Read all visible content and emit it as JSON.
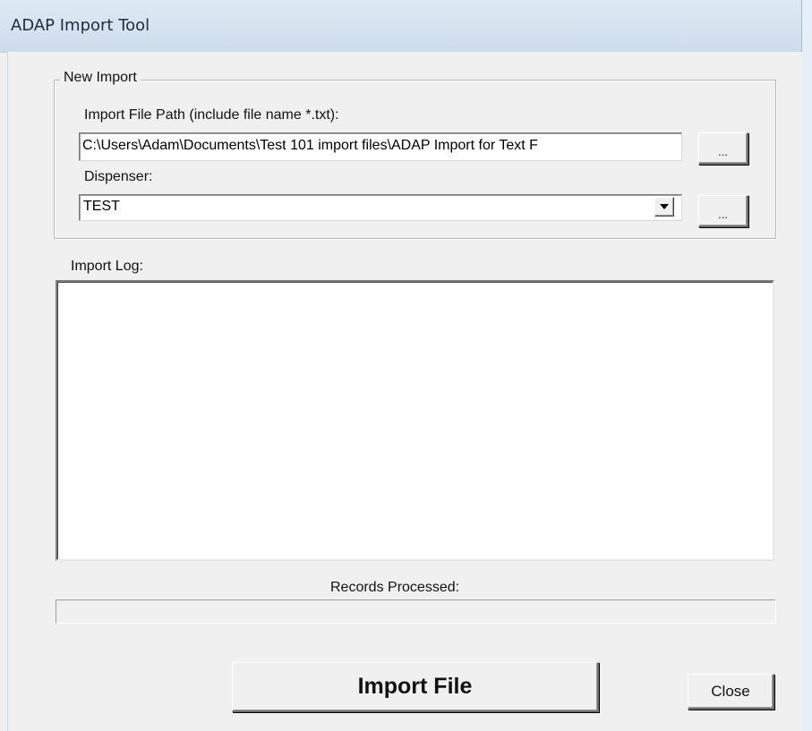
{
  "window": {
    "title": "ADAP Import Tool"
  },
  "new_import": {
    "group_label": "New Import",
    "file_path_label": "Import File Path (include file name *.txt):",
    "file_path_value": "C:\\Users\\Adam\\Documents\\Test 101 import files\\ADAP Import for Text F",
    "browse_label": "...",
    "dispenser_label": "Dispenser:",
    "dispenser_value": "TEST",
    "dispenser_browse_label": "..."
  },
  "import_log": {
    "label": "Import Log:",
    "content": ""
  },
  "records": {
    "label": "Records Processed:",
    "progress_fraction": 0
  },
  "actions": {
    "import_label": "Import File",
    "close_label": "Close"
  },
  "icons": {
    "dropdown_arrow": "chevron-down-icon"
  }
}
